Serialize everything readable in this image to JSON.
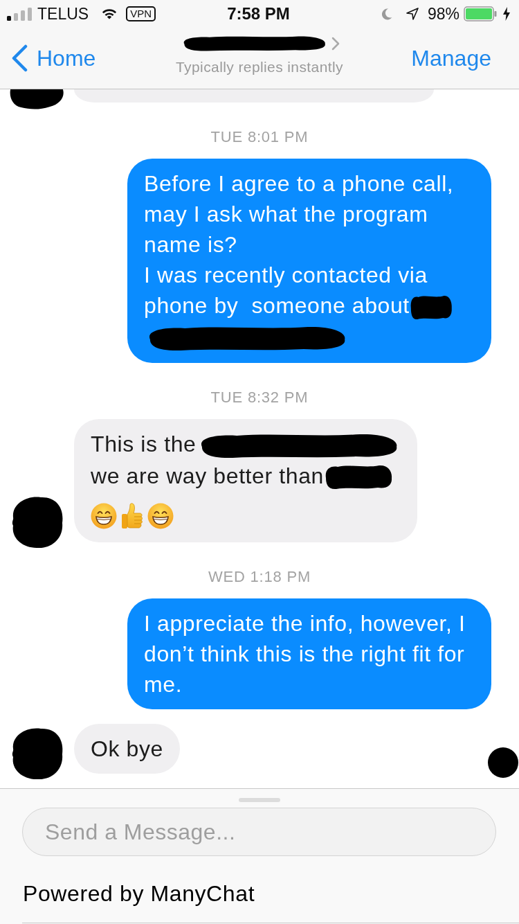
{
  "status_bar": {
    "carrier": "TELUS",
    "vpn": "VPN",
    "time": "7:58 PM",
    "battery": "98%"
  },
  "header": {
    "back": "Home",
    "title_redacted": true,
    "subtitle": "Typically replies instantly",
    "action": "Manage"
  },
  "conversation": {
    "seen": true,
    "items": [
      {
        "kind": "message",
        "outgoing": false,
        "clipped": true
      },
      {
        "kind": "timestamp",
        "text": "TUE 8:01 PM"
      },
      {
        "kind": "message",
        "outgoing": true,
        "clipped": false,
        "lines": [
          [
            {
              "kind": "text",
              "text": "Before I agree to a phone call, may I ask what the program name is?"
            }
          ],
          [
            {
              "kind": "text",
              "text": "I was recently contacted via"
            }
          ],
          [
            {
              "kind": "text",
              "text": "phone by  someone about"
            },
            {
              "kind": "blot"
            },
            {
              "kind": "bar"
            }
          ]
        ]
      },
      {
        "kind": "timestamp",
        "text": "TUE 8:32 PM"
      },
      {
        "kind": "message",
        "outgoing": false,
        "clipped": false,
        "lines": [
          [
            {
              "kind": "text",
              "text": "This is the"
            },
            {
              "kind": "bar"
            }
          ],
          [
            {
              "kind": "text",
              "text": "we are way better than"
            },
            {
              "kind": "smudge"
            }
          ],
          [
            {
              "kind": "grin"
            },
            {
              "kind": "thumbsup"
            },
            {
              "kind": "grin"
            }
          ]
        ]
      },
      {
        "kind": "timestamp",
        "text": "WED 1:18 PM"
      },
      {
        "kind": "message",
        "outgoing": true,
        "clipped": false,
        "lines": [
          [
            {
              "kind": "text",
              "text": "I appreciate the info, however, I don’t think this is the right fit for me."
            }
          ]
        ]
      },
      {
        "kind": "message",
        "outgoing": false,
        "clipped": false,
        "lines": [
          [
            {
              "kind": "text",
              "text": "Ok bye"
            }
          ]
        ]
      }
    ]
  },
  "composer": {
    "placeholder": "Send a Message...",
    "footer": "Powered by ManyChat"
  }
}
